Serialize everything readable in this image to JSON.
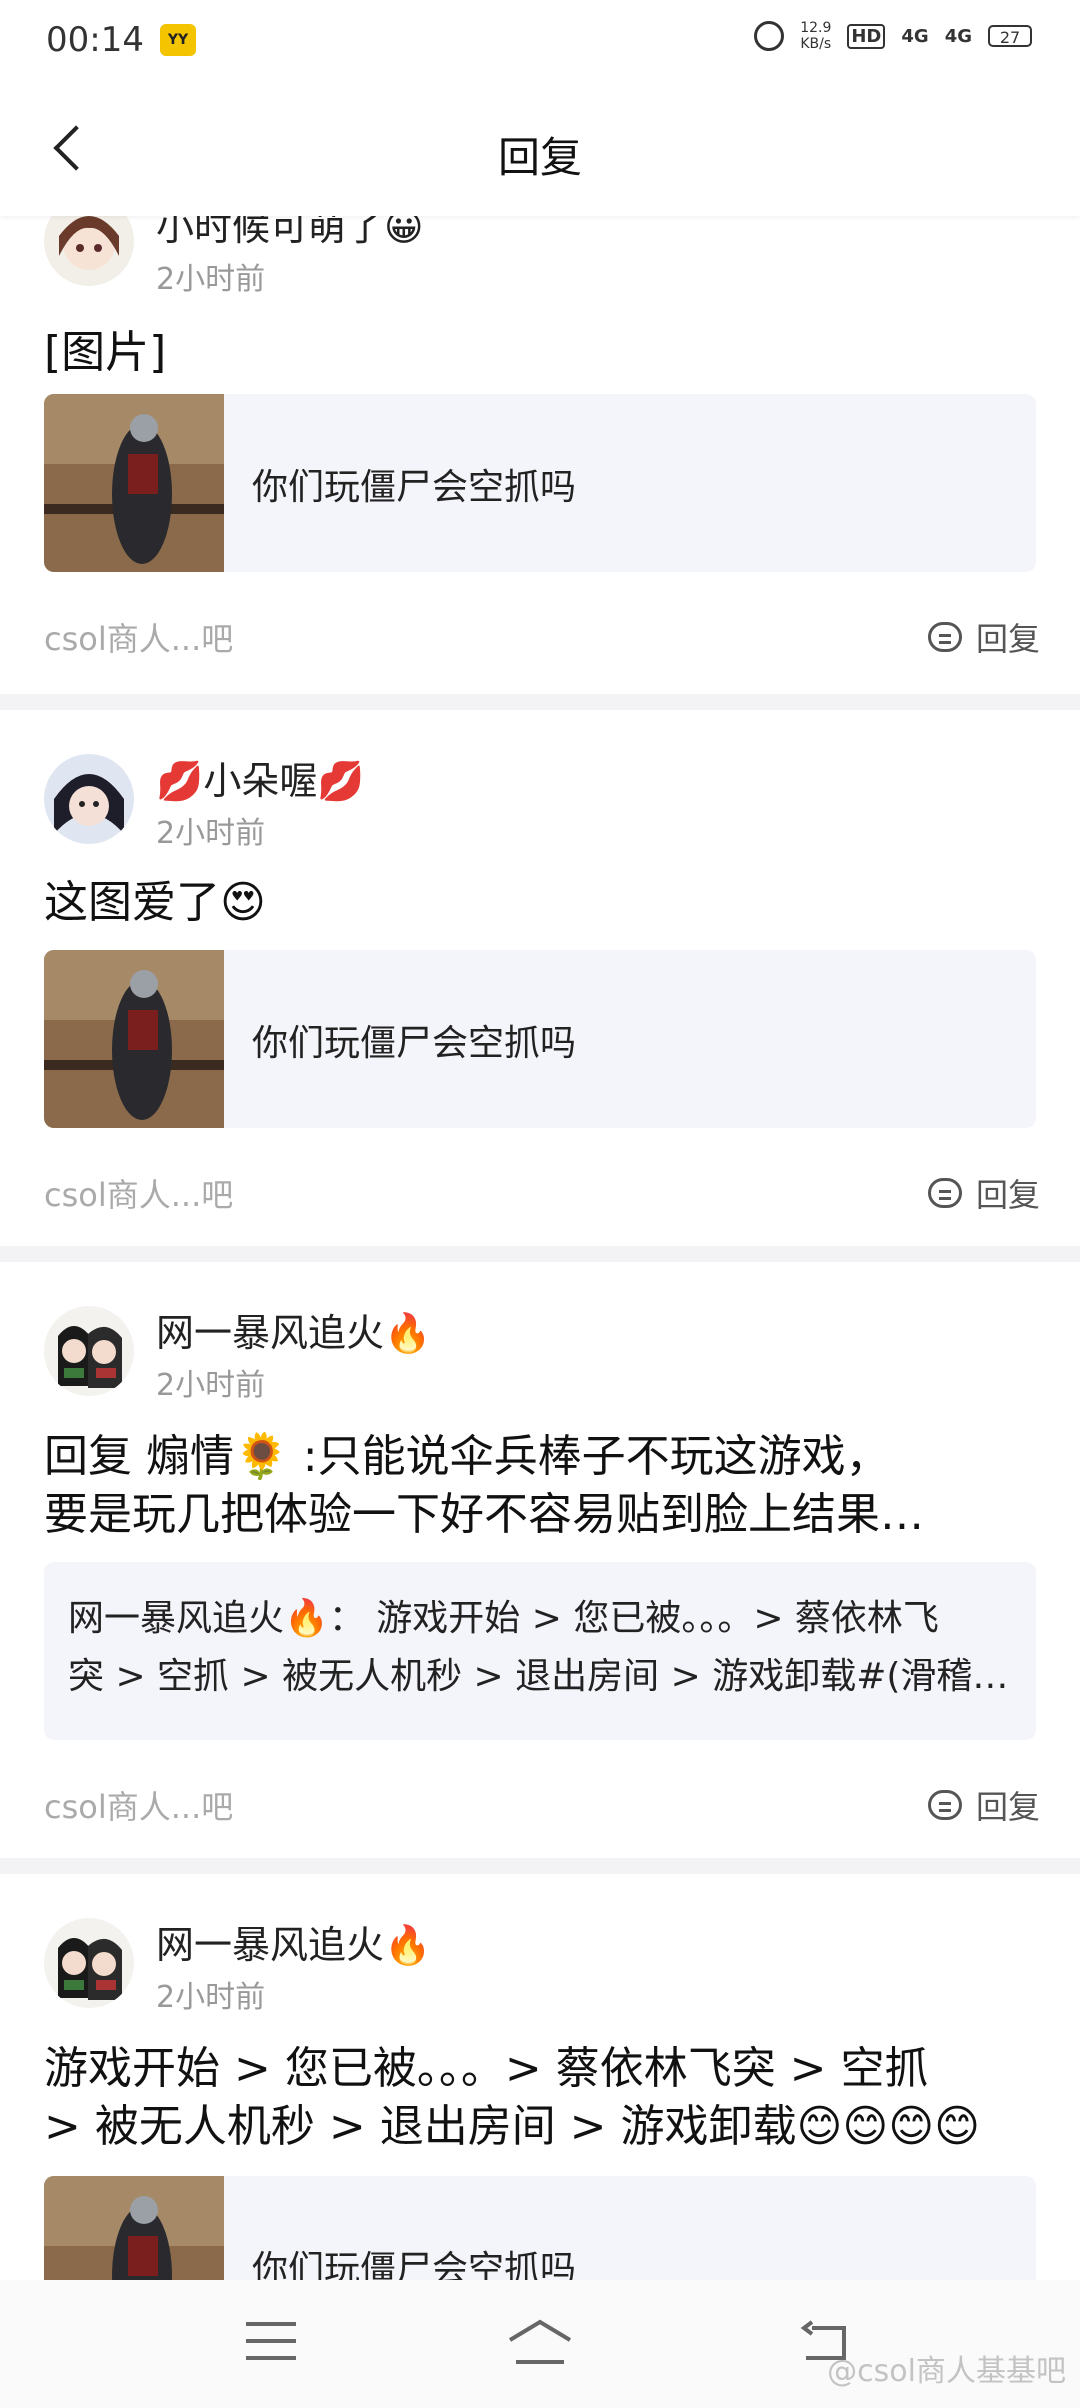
{
  "status_bar": {
    "time": "00:14",
    "app_badge": "YY",
    "net_speed": "12.9",
    "net_unit": "KB/s",
    "hd": "HD",
    "network_1": "4G",
    "network_2": "4G",
    "battery": "27"
  },
  "header": {
    "title": "回复"
  },
  "posts": [
    {
      "username": "小时候可萌了😀",
      "time": "2小时前",
      "content": "[图片]",
      "quote": "你们玩僵尸会空抓吗",
      "source": "csol商人...吧",
      "reply_label": "回复"
    },
    {
      "username_prefix": "💋",
      "username": "小朵喔",
      "username_suffix": "💋",
      "time": "2小时前",
      "content": "这图爱了😍",
      "quote": "你们玩僵尸会空抓吗",
      "source": "csol商人...吧",
      "reply_label": "回复"
    },
    {
      "username": "网一暴风追火🔥",
      "time": "2小时前",
      "content_line1": "回复 煽情🌻 :只能说伞兵棒子不玩这游戏，",
      "content_line2": "要是玩几把体验一下好不容易贴到脸上结果…",
      "quote_line1": "网一暴风追火🔥：  游戏开始 > 您已被。。。> 蔡依林飞",
      "quote_line2": "突 > 空抓 > 被无人机秒 > 退出房间 > 游戏卸载#(滑稽…",
      "source": "csol商人...吧",
      "reply_label": "回复"
    },
    {
      "username": "网一暴风追火🔥",
      "time": "2小时前",
      "content_line1": "游戏开始 > 您已被。。。> 蔡依林飞突 > 空抓",
      "content_line2": " > 被无人机秒 > 退出房间 > 游戏卸载😊😊😊😊",
      "quote": "你们玩僵尸会空抓吗"
    }
  ],
  "watermark": "@csol商人基基吧"
}
